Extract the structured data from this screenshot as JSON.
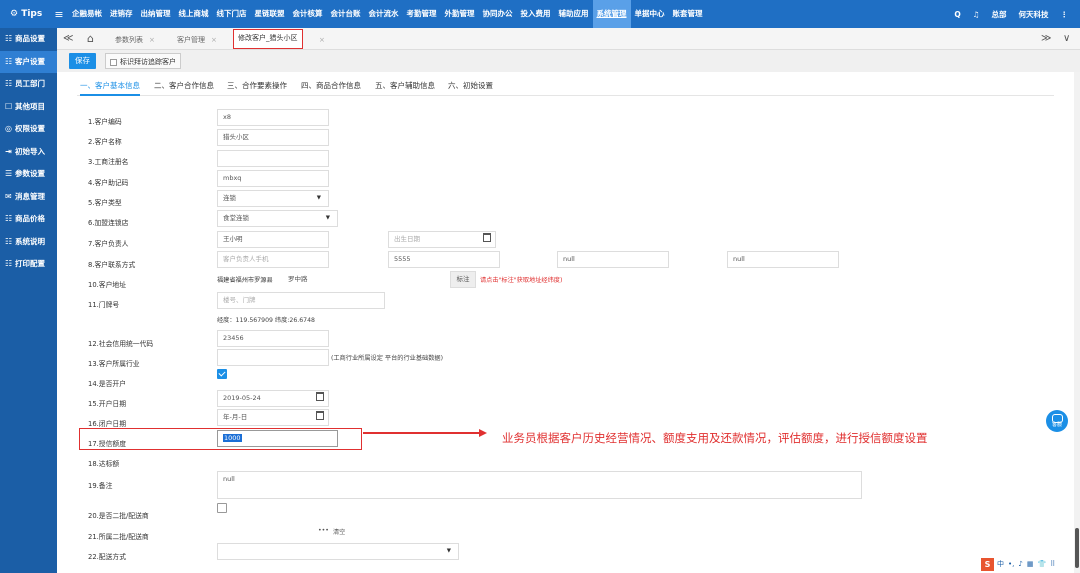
{
  "app": {
    "logo": "⚙ Tips",
    "menu_icon": "≡"
  },
  "topnav": [
    "企融易帐",
    "进销存",
    "出纳管理",
    "线上商城",
    "线下门店",
    "星链联盟",
    "会计核算",
    "会计台账",
    "会计流水",
    "考勤管理",
    "外勤管理",
    "协同办公",
    "投入费用",
    "辅助应用",
    "系统管理",
    "单据中心",
    "账套管理"
  ],
  "topnav_active": "系统管理",
  "topright": {
    "search": "Q",
    "bell": "♫",
    "user": "总部",
    "company": "何天科技",
    "more": "⋮"
  },
  "sidebar": [
    {
      "icon": "☷",
      "label": "商品设置"
    },
    {
      "icon": "☷",
      "label": "客户设置",
      "active": true
    },
    {
      "icon": "☷",
      "label": "员工部门"
    },
    {
      "icon": "☐",
      "label": "其他项目"
    },
    {
      "icon": "◎",
      "label": "权限设置"
    },
    {
      "icon": "⇥",
      "label": "初始导入"
    },
    {
      "icon": "☰",
      "label": "参数设置"
    },
    {
      "icon": "✉",
      "label": "消息管理"
    },
    {
      "icon": "☷",
      "label": "商品价格"
    },
    {
      "icon": "☷",
      "label": "系统说明"
    },
    {
      "icon": "☷",
      "label": "打印配置"
    }
  ],
  "tabs": {
    "nav_left": "≪",
    "home": "⌂",
    "items": [
      "参数列表",
      "客户管理"
    ],
    "current": "修改客户_猎头小区",
    "close": "×",
    "nav_right": "≫",
    "chev": "∨"
  },
  "toolbar": {
    "save": "保存",
    "mark": "标识拜访追踪客户"
  },
  "section_tabs": [
    "一、客户基本信息",
    "二、客户合作信息",
    "三、合作要素操作",
    "四、商品合作信息",
    "五、客户辅助信息",
    "六、初始设置"
  ],
  "form": {
    "f1": {
      "label": "1.客户编码",
      "value": "x8"
    },
    "f2": {
      "label": "2.客户名称",
      "value": "猎头小区"
    },
    "f3": {
      "label": "3.工商注册名",
      "value": ""
    },
    "f4": {
      "label": "4.客户助记码",
      "value": "mbxq"
    },
    "f5": {
      "label": "5.客户类型",
      "value": "连锁",
      "arrow": "▼"
    },
    "f6": {
      "label": "6.加盟连锁店",
      "value": "食堂连锁",
      "arrow": "▼"
    },
    "f7": {
      "label": "7.客户负责人",
      "value": "王小明",
      "birth_placeholder": "出生日期"
    },
    "f8": {
      "label": "8.客户联系方式",
      "phone_placeholder": "客户负责人手机",
      "tel": "5555",
      "v3": "null",
      "v4": "null"
    },
    "f10": {
      "label": "10.客户地址",
      "region": "福建省福州市罗源县",
      "street": "罗中路",
      "btn": "标注",
      "hint": "请点击\"标注\"获取地址经纬度)"
    },
    "f11": {
      "label": "11.门牌号",
      "placeholder": "楼号、门牌",
      "coords": "经度：119.567909   纬度:26.6748"
    },
    "f12": {
      "label": "12.社会信用统一代码",
      "value": "23456"
    },
    "f13": {
      "label": "13.客户所属行业",
      "value": "",
      "note": "(工商行业所属设定 平台的行业基础数据)"
    },
    "f14": {
      "label": "14.是否开户",
      "checked": true
    },
    "f15": {
      "label": "15.开户日期",
      "value": "2019-05-24"
    },
    "f16": {
      "label": "16.闭户日期",
      "value": "年-月-日"
    },
    "f17": {
      "label": "17.授信额度",
      "value": "1000"
    },
    "f18": {
      "label": "18.达标额",
      "value": ""
    },
    "f19": {
      "label": "19.备注",
      "value": "null"
    },
    "f20": {
      "label": "20.是否二批/配送商",
      "checked": false
    },
    "f21": {
      "label": "21.所属二批/配送商",
      "dots": "•••",
      "clear": "清空"
    },
    "f22": {
      "label": "22.配送方式",
      "arrow": "▼"
    }
  },
  "annotation": "业务员根据客户历史经营情况、额度支用及还款情况，评估额度，进行授信额度设置",
  "kefu": "客服",
  "ime": {
    "logo": "S",
    "items": [
      "中",
      "•,",
      "♪",
      "▦",
      "👕",
      "⠿"
    ]
  }
}
